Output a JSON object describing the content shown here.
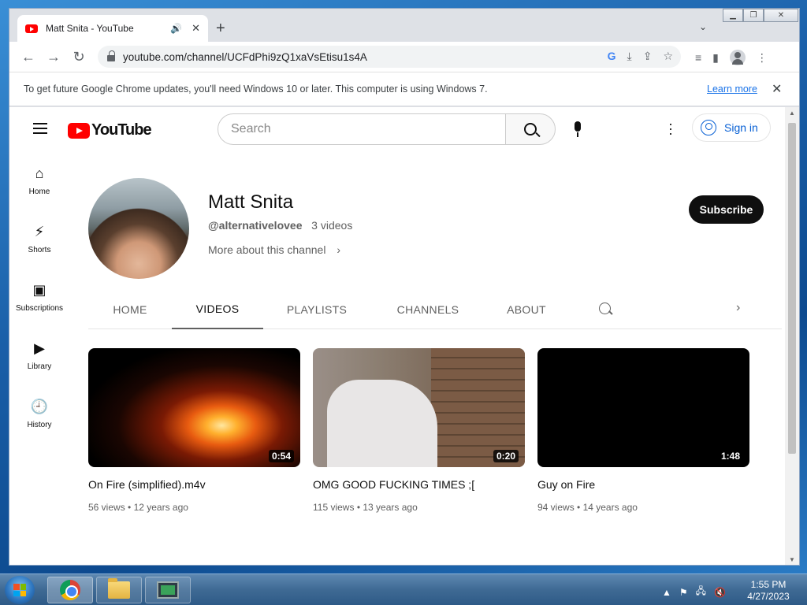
{
  "browser": {
    "tab_title": "Matt Snita - YouTube",
    "url": "youtube.com/channel/UCFdPhi9zQ1xaVsEtisu1s4A",
    "infobar_text": "To get future Google Chrome updates, you'll need Windows 10 or later. This computer is using Windows 7.",
    "infobar_link": "Learn more"
  },
  "youtube": {
    "logo_text": "YouTube",
    "search_placeholder": "Search",
    "sign_in_label": "Sign in",
    "sidebar": [
      {
        "label": "Home",
        "icon": "home-icon"
      },
      {
        "label": "Shorts",
        "icon": "shorts-icon"
      },
      {
        "label": "Subscriptions",
        "icon": "subscriptions-icon"
      },
      {
        "label": "Library",
        "icon": "library-icon"
      },
      {
        "label": "History",
        "icon": "history-icon"
      }
    ],
    "channel": {
      "name": "Matt Snita",
      "handle": "@alternativelovee",
      "video_count": "3 videos",
      "more_about": "More about this channel",
      "subscribe_label": "Subscribe"
    },
    "tabs": [
      "HOME",
      "VIDEOS",
      "PLAYLISTS",
      "CHANNELS",
      "ABOUT"
    ],
    "active_tab": "VIDEOS",
    "videos": [
      {
        "title": "On Fire (simplified).m4v",
        "duration": "0:54",
        "views": "56 views",
        "age": "12 years ago"
      },
      {
        "title": "OMG GOOD FUCKING TIMES ;[",
        "duration": "0:20",
        "views": "115 views",
        "age": "13 years ago"
      },
      {
        "title": "Guy on Fire",
        "duration": "1:48",
        "views": "94 views",
        "age": "14 years ago"
      }
    ]
  },
  "taskbar": {
    "time": "1:55 PM",
    "date": "4/27/2023"
  },
  "colors": {
    "yt_red": "#ff0000",
    "link_blue": "#065fd4",
    "chrome_link": "#1a73e8"
  }
}
